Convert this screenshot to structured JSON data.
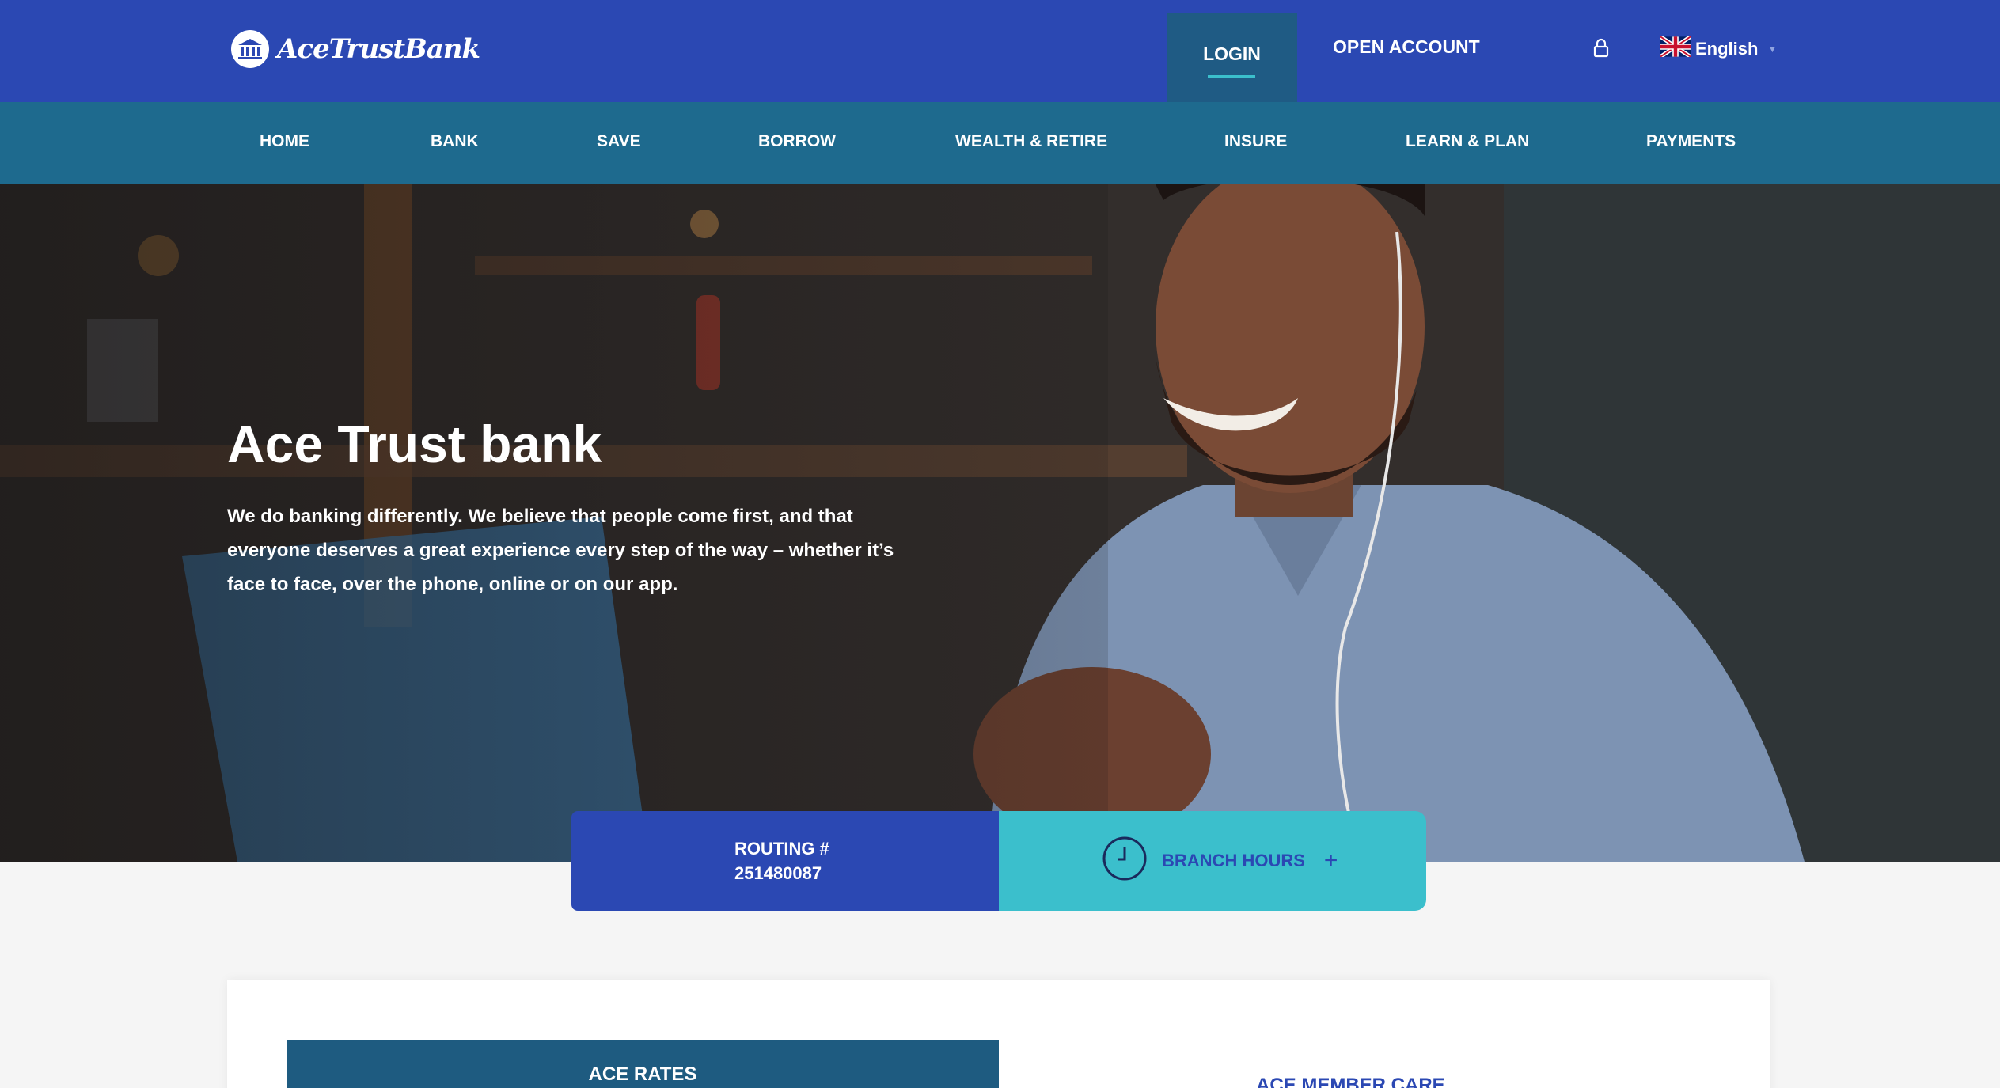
{
  "brand": {
    "name": "AceTrustBank",
    "primary_color": "#2b48b3",
    "nav_color": "#1e6a8e",
    "accent_color": "#3bbfcc"
  },
  "header": {
    "login_label": "LOGIN",
    "open_account_label": "OPEN ACCOUNT",
    "lock_icon": "lock-icon",
    "language": {
      "label": "English",
      "flag_icon": "uk-flag-icon"
    }
  },
  "nav": {
    "items": [
      {
        "label": "HOME"
      },
      {
        "label": "BANK"
      },
      {
        "label": "SAVE"
      },
      {
        "label": "BORROW"
      },
      {
        "label": "WEALTH & RETIRE"
      },
      {
        "label": "INSURE"
      },
      {
        "label": "LEARN & PLAN"
      },
      {
        "label": "PAYMENTS"
      }
    ]
  },
  "hero": {
    "title": "Ace Trust bank",
    "description": "We do banking differently. We believe that people come first, and that everyone deserves a great experience every step of the way – whether it’s face to face, over the phone, online or on our app."
  },
  "info": {
    "routing_label": "ROUTING #",
    "routing_number": "251480087",
    "branch_hours_label": "BRANCH HOURS",
    "clock_icon": "clock-icon",
    "plus_icon": "plus-icon"
  },
  "content": {
    "rates_title": "ACE RATES",
    "member_care_title": "ACE MEMBER CARE"
  }
}
